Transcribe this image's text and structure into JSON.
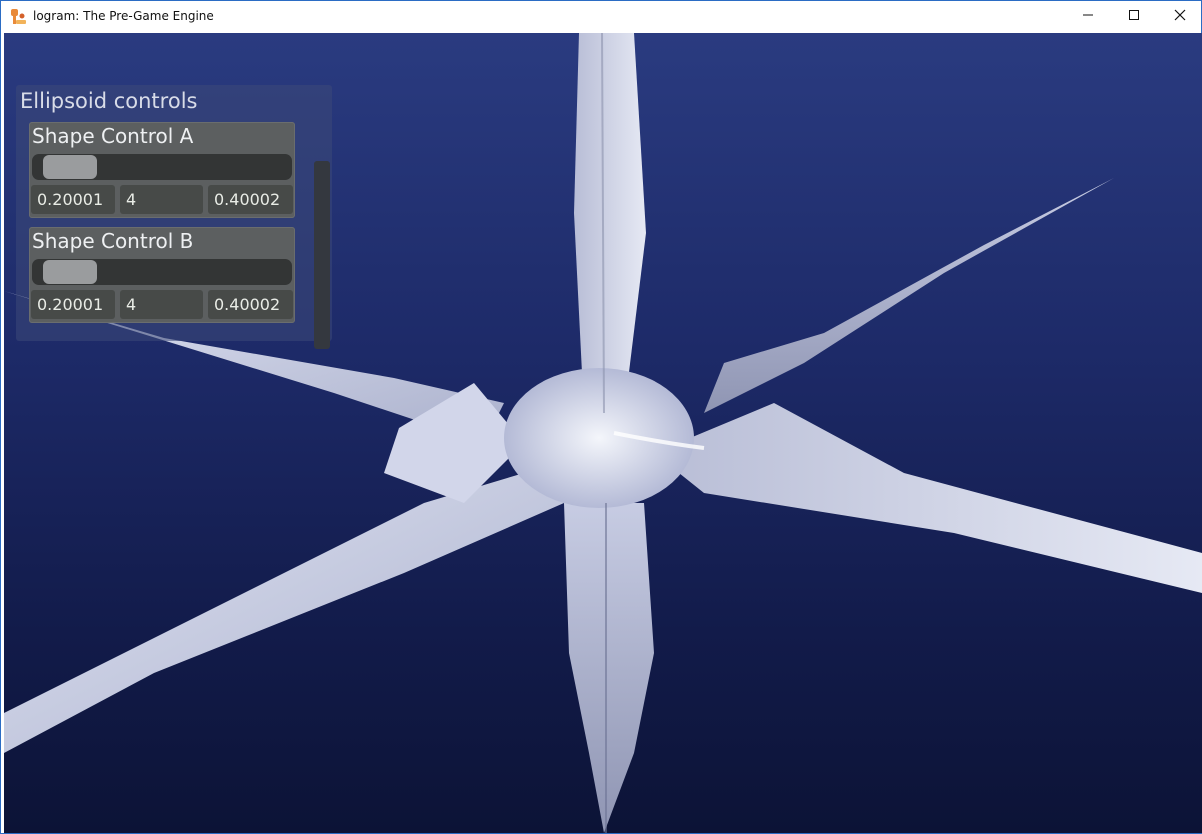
{
  "window": {
    "title": "logram: The Pre-Game Engine",
    "accent_color": "#2b6cc4",
    "icons": [
      "app-logo-icon",
      "minimize-icon",
      "maximize-icon",
      "close-icon"
    ]
  },
  "scene": {
    "background_colors": [
      "#2a3b80",
      "#0c1336"
    ],
    "object_color": "#c8cde6"
  },
  "panel": {
    "title": "Ellipsoid controls",
    "controls": [
      {
        "label": "Shape Control A",
        "slider_fraction": 0.2,
        "fields": [
          "0.20001",
          "4",
          "0.40002"
        ]
      },
      {
        "label": "Shape Control B",
        "slider_fraction": 0.2,
        "fields": [
          "0.20001",
          "4",
          "0.40002"
        ]
      }
    ]
  }
}
